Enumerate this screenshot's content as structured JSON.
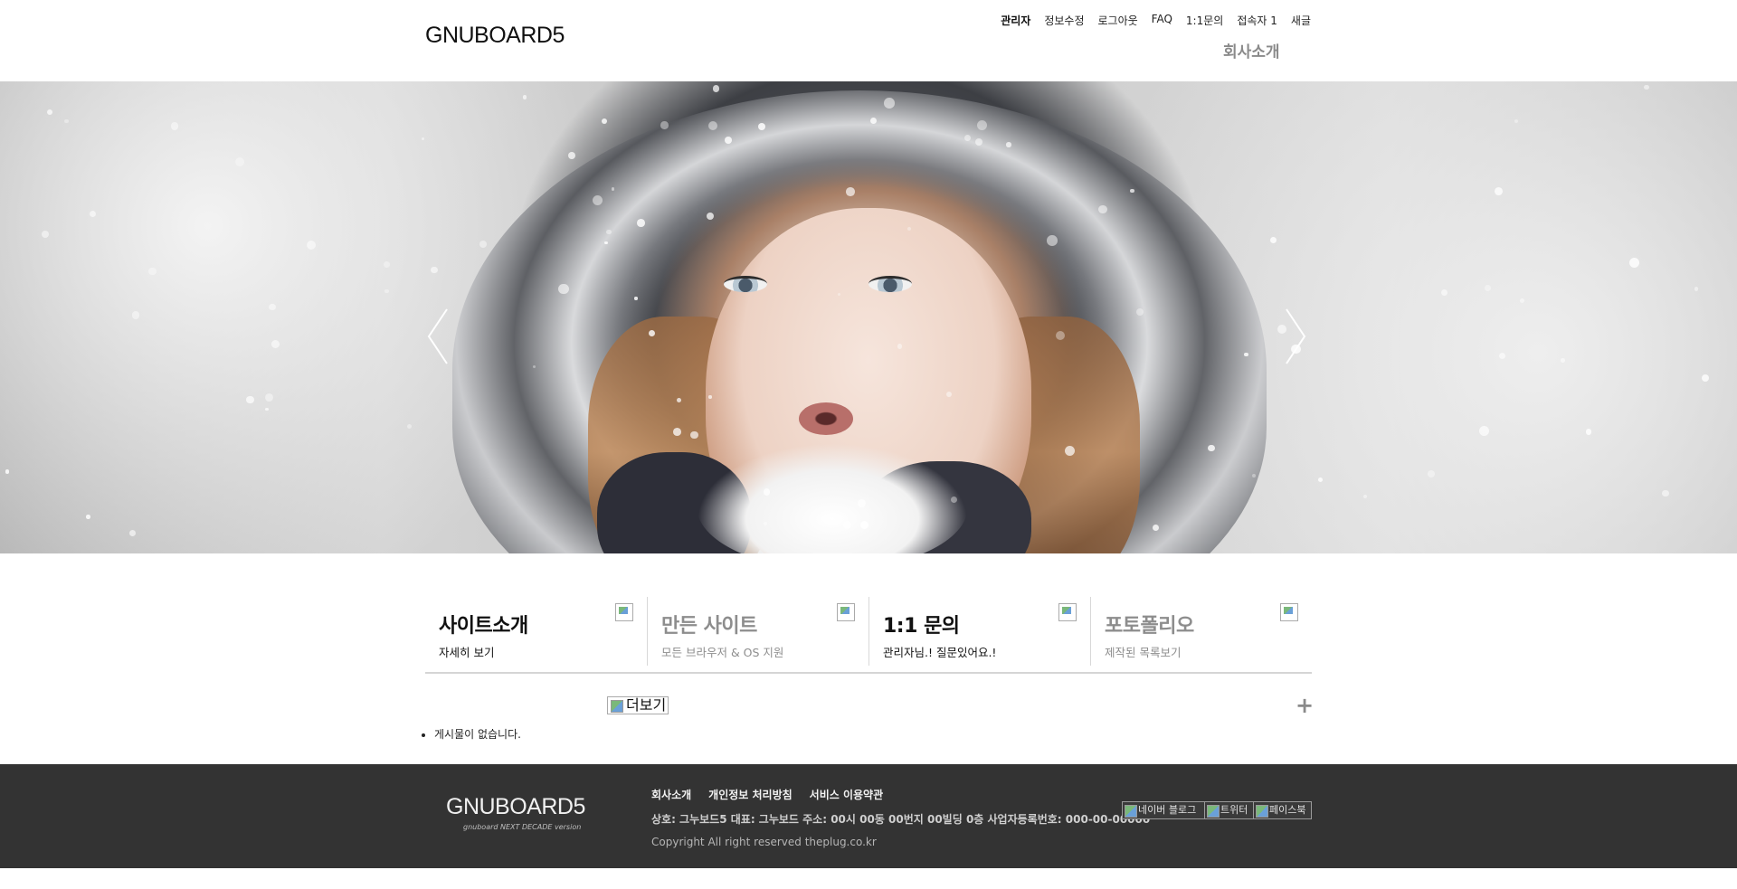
{
  "header": {
    "logo": "GNUBOARD5",
    "nav": [
      "관리자",
      "정보수정",
      "로그아웃",
      "FAQ",
      "1:1문의",
      "접속자 1",
      "새글"
    ],
    "company_menu": "회사소개"
  },
  "hero": {
    "prev_icon": "chevron-left-icon",
    "next_icon": "chevron-right-icon",
    "slide_count": 2,
    "active_slide": 2
  },
  "features": [
    {
      "title": "사이트소개",
      "subtitle": "자세히 보기",
      "tone": "dark"
    },
    {
      "title": "만든 사이트",
      "subtitle": "모든 브라우저 & OS 지원",
      "tone": "light"
    },
    {
      "title": "1:1 문의",
      "subtitle": "관리자님.! 질문있어요.!",
      "tone": "dark"
    },
    {
      "title": "포토폴리오",
      "subtitle": "제작된 목록보기",
      "tone": "light"
    }
  ],
  "latest": {
    "more_alt": "더보기",
    "plus_icon": "plus-icon",
    "empty_text": "게시물이 없습니다."
  },
  "footer": {
    "logo": "GNUBOARD5",
    "tagline": "gnuboard NEXT DECADE version",
    "links": [
      "회사소개",
      "개인정보 처리방침",
      "서비스 이용약관"
    ],
    "info": "상호: 그누보드5   대표: 그누보드   주소: 00시 00동 00번지 00빌딩 0층   사업자등록번호: 000-00-00000",
    "copyright": "Copyright All right reserved theplug.co.kr",
    "sns": [
      "네이버 블로그",
      "트위터",
      "페이스북"
    ]
  },
  "colors": {
    "footer_bg": "#333333",
    "feature_dark": "#111111",
    "feature_light": "#8d8d8d"
  }
}
